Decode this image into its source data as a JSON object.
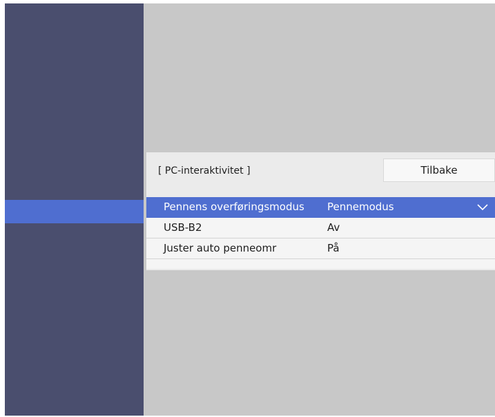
{
  "menu": {
    "title": "[ PC-interaktivitet ]",
    "back_label": "Tilbake",
    "items": [
      {
        "label": "Pennens overføringsmodus",
        "value": "Pennemodus",
        "selected": true,
        "icon": "chevron-down-icon"
      },
      {
        "label": "USB-B2",
        "value": "Av",
        "selected": false
      },
      {
        "label": "Juster auto penneomr",
        "value": "På",
        "selected": false
      }
    ]
  },
  "colors": {
    "sidebar": "#4a4e6e",
    "highlight": "#4f6ed0",
    "background": "#c8c8c8",
    "panel": "#ebebeb"
  }
}
